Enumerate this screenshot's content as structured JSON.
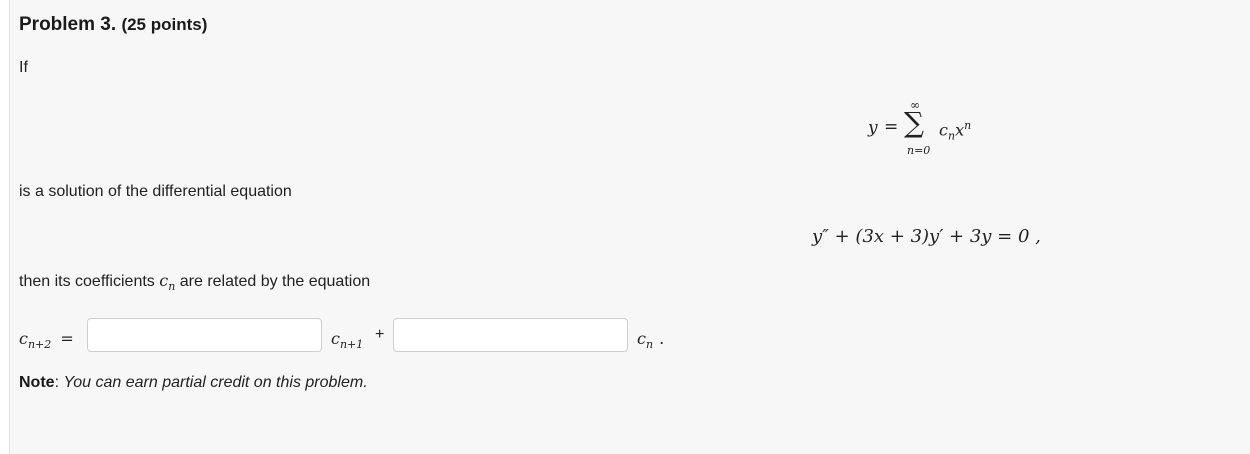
{
  "problem": {
    "title": "Problem 3.",
    "points": "(25 points)"
  },
  "text": {
    "if": "If",
    "is_solution": "is a solution of the differential equation",
    "coefficients_prefix": "then its coefficients",
    "coefficients_suffix": "are related by the equation",
    "plus": "+",
    "period": "."
  },
  "math": {
    "y": "y",
    "equals": "=",
    "sigma": "∑",
    "upper_limit": "∞",
    "lower_limit": "n=0",
    "c": "c",
    "n": "n",
    "x": "x",
    "diffeq": "y″ + (3x + 3)y′ + 3y = 0 ,",
    "sub_n2": "n+2",
    "sub_n1": "n+1"
  },
  "inputs": {
    "coef1_value": "",
    "coef2_value": ""
  },
  "note": {
    "label": "Note",
    "colon": ":",
    "text": "You can earn partial credit on this problem."
  }
}
